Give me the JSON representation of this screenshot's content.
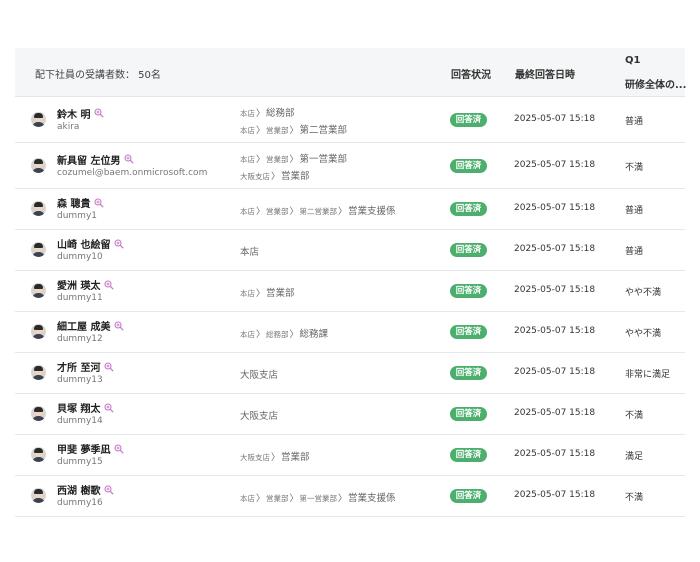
{
  "header": {
    "count_label": "配下社員の受講者数： 50名",
    "status_col": "回答状況",
    "date_col": "最終回答日時",
    "q1_col": "Q1",
    "q1_sub": "研修全体の..."
  },
  "rows": [
    {
      "name": "鈴木 明",
      "sub": "akira",
      "dept_lines": [
        [
          "本店",
          "総務部"
        ],
        [
          "本店",
          "営業部",
          "第二営業部"
        ]
      ],
      "status": "回答済",
      "date": "2025-05-07 15:18",
      "answer": "普通"
    },
    {
      "name": "新具留 左位男",
      "sub": "cozumel@baem.onmicrosoft.com",
      "dept_lines": [
        [
          "本店",
          "営業部",
          "第一営業部"
        ],
        [
          "大阪支店",
          "営業部"
        ]
      ],
      "status": "回答済",
      "date": "2025-05-07 15:18",
      "answer": "不満"
    },
    {
      "name": "森 聰貴",
      "sub": "dummy1",
      "dept_lines": [
        [
          "本店",
          "営業部",
          "第二営業部",
          "営業支援係"
        ]
      ],
      "status": "回答済",
      "date": "2025-05-07 15:18",
      "answer": "普通"
    },
    {
      "name": "山崎 也絵留",
      "sub": "dummy10",
      "dept_lines": [
        [
          "本店"
        ]
      ],
      "status": "回答済",
      "date": "2025-05-07 15:18",
      "answer": "普通"
    },
    {
      "name": "愛洲 瑛太",
      "sub": "dummy11",
      "dept_lines": [
        [
          "本店",
          "営業部"
        ]
      ],
      "status": "回答済",
      "date": "2025-05-07 15:18",
      "answer": "やや不満"
    },
    {
      "name": "細工屋 成美",
      "sub": "dummy12",
      "dept_lines": [
        [
          "本店",
          "総務部",
          "総務課"
        ]
      ],
      "status": "回答済",
      "date": "2025-05-07 15:18",
      "answer": "やや不満"
    },
    {
      "name": "才所 至河",
      "sub": "dummy13",
      "dept_lines": [
        [
          "大阪支店"
        ]
      ],
      "status": "回答済",
      "date": "2025-05-07 15:18",
      "answer": "非常に満足"
    },
    {
      "name": "貝塚 翔太",
      "sub": "dummy14",
      "dept_lines": [
        [
          "大阪支店"
        ]
      ],
      "status": "回答済",
      "date": "2025-05-07 15:18",
      "answer": "不満"
    },
    {
      "name": "甲斐 夢季凪",
      "sub": "dummy15",
      "dept_lines": [
        [
          "大阪支店",
          "営業部"
        ]
      ],
      "status": "回答済",
      "date": "2025-05-07 15:18",
      "answer": "満足"
    },
    {
      "name": "西湖 樹歌",
      "sub": "dummy16",
      "dept_lines": [
        [
          "本店",
          "営業部",
          "第一営業部",
          "営業支援係"
        ]
      ],
      "status": "回答済",
      "date": "2025-05-07 15:18",
      "answer": "不満"
    }
  ],
  "colors": {
    "badge": "#4caf6e",
    "zoom_icon": "#c678c8",
    "header_bg": "#f5f6f7"
  },
  "icons": {
    "zoom": "zoom-in-icon",
    "avatar": "user-avatar"
  }
}
